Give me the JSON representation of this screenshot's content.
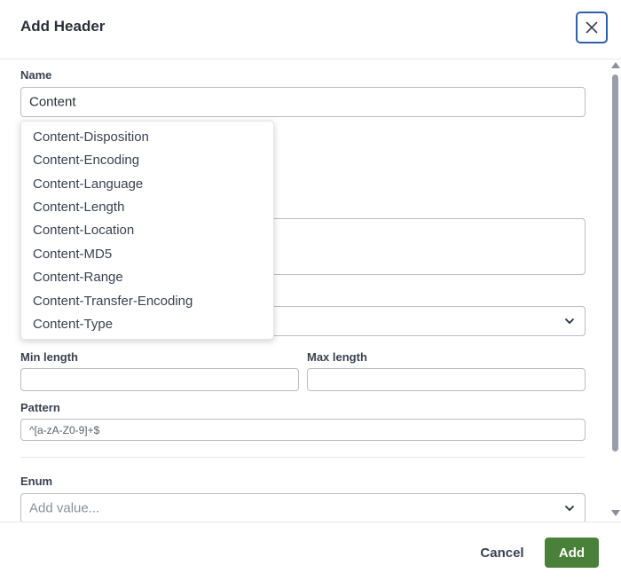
{
  "dialog": {
    "title": "Add Header"
  },
  "form": {
    "name": {
      "label": "Name",
      "value": "Content"
    },
    "min_length": {
      "label": "Min length",
      "value": ""
    },
    "max_length": {
      "label": "Max length",
      "value": ""
    },
    "pattern": {
      "label": "Pattern",
      "value": "^[a-zA-Z0-9]+$"
    },
    "enum": {
      "label": "Enum",
      "placeholder": "Add value..."
    }
  },
  "autocomplete": {
    "items": [
      "Content-Disposition",
      "Content-Encoding",
      "Content-Language",
      "Content-Length",
      "Content-Location",
      "Content-MD5",
      "Content-Range",
      "Content-Transfer-Encoding",
      "Content-Type"
    ]
  },
  "footer": {
    "cancel_label": "Cancel",
    "add_label": "Add"
  },
  "colors": {
    "primary": "#49803a",
    "focus": "#2f5ea8",
    "text": "#3b4151"
  },
  "icons": {
    "close": "close-icon",
    "chevron": "chevron-down-icon"
  }
}
